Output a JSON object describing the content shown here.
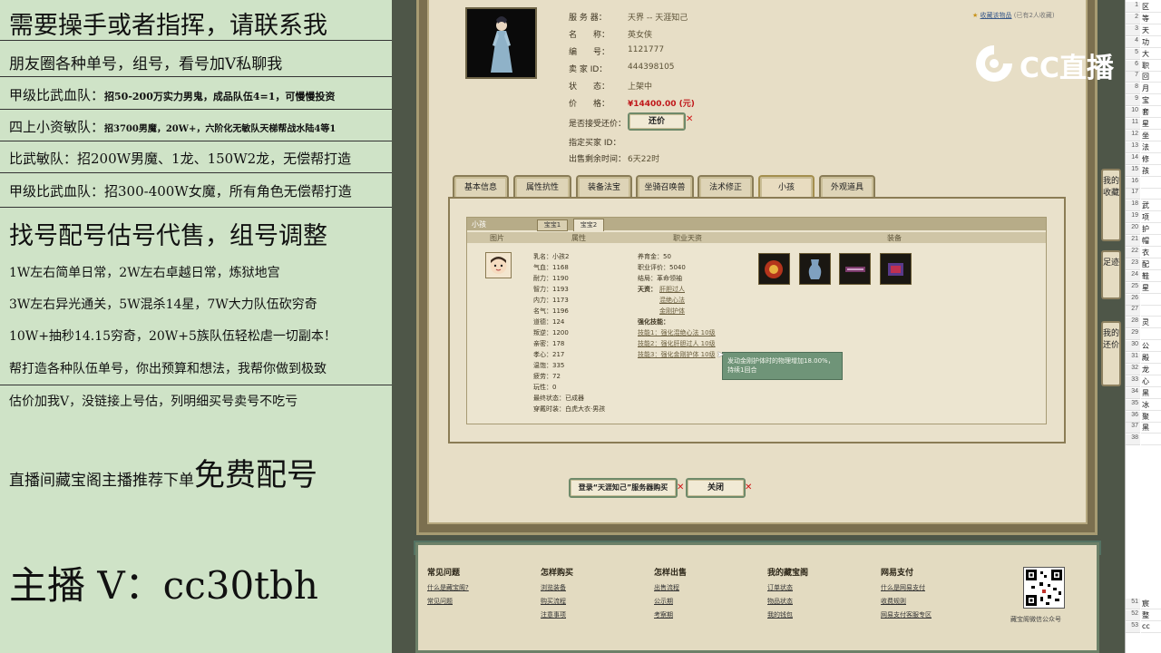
{
  "overlay": {
    "line1": "需要操手或者指挥，请联系我",
    "line2": "朋友圈各种单号，组号，看号加V私聊我",
    "line3a": "甲级比武血队：",
    "line3b": "招50-200万实力男鬼，成品队伍4=1，可慢慢投资",
    "line4a": "四上小资敏队：",
    "line4b": "招3700男魔，20W+，六阶化无敏队天梯帮战水陆4等1",
    "line5": "比武敏队：招200W男魔、1龙、150W2龙，无偿帮打造",
    "line6": "甲级比武血队：招300-400W女魔，所有角色无偿帮打造",
    "line7": "找号配号估号代售，组号调整",
    "line8": "1W左右简单日常，2W左右卓越日常，炼狱地宫",
    "line9": "3W左右异光通关，5W混杀14星，7W大力队伍砍穷奇",
    "line10": "10W+抽秒14.15穷奇，20W+5族队伍轻松虐一切副本！",
    "line11": "帮打造各种队伍单号，你出预算和想法，我帮你做到极致",
    "line12": "估价加我V，没链接上号估，列明细买号卖号不吃亏",
    "line13a": "直播间藏宝阁主播推荐下单",
    "line13b": "免费配号",
    "line14": "主播 V：cc30tbh"
  },
  "item": {
    "server_label": "服 务 器：",
    "server_value": "天界 -- 天涯知己",
    "name_label": "名　　称：",
    "name_value": "英女侠",
    "id_label": "编　　号：",
    "id_value": "1121777",
    "seller_label": "卖 家 ID：",
    "seller_value": "444398105",
    "status_label": "状　　态：",
    "status_value": "上架中",
    "price_label": "价　　格：",
    "price_value": "¥14400.00 (元)",
    "bargain_label": "是否接受还价：",
    "bargain_button": "还价",
    "buyer_label": "指定买家 ID：",
    "time_label": "出售剩余时间：",
    "time_value": "6天22时",
    "favorite_link": "收藏该物品",
    "favorite_count": "(已有2人收藏)"
  },
  "tabs": [
    {
      "label": "基本信息"
    },
    {
      "label": "属性抗性"
    },
    {
      "label": "装备法宝"
    },
    {
      "label": "坐骑召唤兽"
    },
    {
      "label": "法术修正"
    },
    {
      "label": "小孩"
    },
    {
      "label": "外观道具"
    }
  ],
  "child_panel": {
    "title": "小孩",
    "sub_tabs": [
      "宝宝1",
      "宝宝2"
    ],
    "col_photo": "图片",
    "col_attr": "属性",
    "col_job": "职业天资",
    "col_equip": "装备",
    "attrs": [
      "乳名：小孩2",
      "气血：1168",
      "耐力：1190",
      "智力：1193",
      "内力：1173",
      "名气：1196",
      "道德：124",
      "叛逆：1200",
      "亲密：178",
      "孝心：217",
      "温饱：335",
      "疲劳：72",
      "玩性：0",
      "最终状态：已成器",
      "穿戴时装：白虎大衣·男孩"
    ],
    "job": {
      "food": "养育金：50",
      "score": "职业评价：5040",
      "ending": "结局：革命领袖",
      "talent_label": "天资：",
      "talents": [
        "肝胆过人",
        "混绝心法",
        "金刚护体"
      ],
      "skill_label": "强化技能：",
      "skills": [
        "技能1：强化混绝心法 10级",
        "技能2：强化肝胆过人 10级",
        "技能3：强化金刚护体 10级"
      ]
    },
    "tooltip": "发动金刚护体时的物理增加18.00%，持续1回合"
  },
  "buttons": {
    "login_buy": "登录“天涯知己”服务器购买",
    "close": "关闭"
  },
  "side_tabs": [
    "我的收藏",
    "足迹",
    "我的还价"
  ],
  "footer": {
    "col1_title": "常见问题",
    "col1_links": [
      "什么是藏宝阁?",
      "常见问题"
    ],
    "col2_title": "怎样购买",
    "col2_links": [
      "浏览装备",
      "购买流程",
      "注意事项"
    ],
    "col3_title": "怎样出售",
    "col3_links": [
      "出售流程",
      "公示期",
      "考察期"
    ],
    "col4_title": "我的藏宝阁",
    "col4_links": [
      "订单状态",
      "物品状态",
      "我的钱包"
    ],
    "col5_title": "网易支付",
    "col5_links": [
      "什么是网易支付",
      "收费规则",
      "网易支付客服专区"
    ],
    "qr_caption": "藏宝阁微信公众号"
  },
  "logo_text": "CC直播",
  "sheet": {
    "rows": [
      {
        "n": "1",
        "t": "区"
      },
      {
        "n": "2",
        "t": "等"
      },
      {
        "n": "3",
        "t": "天"
      },
      {
        "n": "4",
        "t": "功"
      },
      {
        "n": "5",
        "t": "大"
      },
      {
        "n": "6",
        "t": "职"
      },
      {
        "n": "7",
        "t": "回"
      },
      {
        "n": "8",
        "t": "月"
      },
      {
        "n": "9",
        "t": "宝"
      },
      {
        "n": "10",
        "t": "套"
      },
      {
        "n": "11",
        "t": "星"
      },
      {
        "n": "12",
        "t": "坐"
      },
      {
        "n": "13",
        "t": "法"
      },
      {
        "n": "14",
        "t": "修"
      },
      {
        "n": "15",
        "t": "孩"
      },
      {
        "n": "16",
        "t": ""
      },
      {
        "n": "17",
        "t": ""
      },
      {
        "n": "18",
        "t": "武"
      },
      {
        "n": "19",
        "t": "项"
      },
      {
        "n": "20",
        "t": "护"
      },
      {
        "n": "21",
        "t": "帽"
      },
      {
        "n": "22",
        "t": "衣"
      },
      {
        "n": "23",
        "t": "配"
      },
      {
        "n": "24",
        "t": "鞋"
      },
      {
        "n": "25",
        "t": "星"
      },
      {
        "n": "26",
        "t": ""
      },
      {
        "n": "27",
        "t": ""
      },
      {
        "n": "28",
        "t": "灵"
      },
      {
        "n": "29",
        "t": ""
      },
      {
        "n": "30",
        "t": "公"
      },
      {
        "n": "31",
        "t": "殿"
      },
      {
        "n": "32",
        "t": "龙"
      },
      {
        "n": "33",
        "t": "心"
      },
      {
        "n": "34",
        "t": "黑"
      },
      {
        "n": "35",
        "t": "冰"
      },
      {
        "n": "36",
        "t": "聚"
      },
      {
        "n": "37",
        "t": "黑"
      },
      {
        "n": "38",
        "t": ""
      }
    ],
    "tail": [
      {
        "n": "51",
        "t": "宸"
      },
      {
        "n": "52",
        "t": "整"
      },
      {
        "n": "53",
        "t": "cc"
      }
    ]
  }
}
